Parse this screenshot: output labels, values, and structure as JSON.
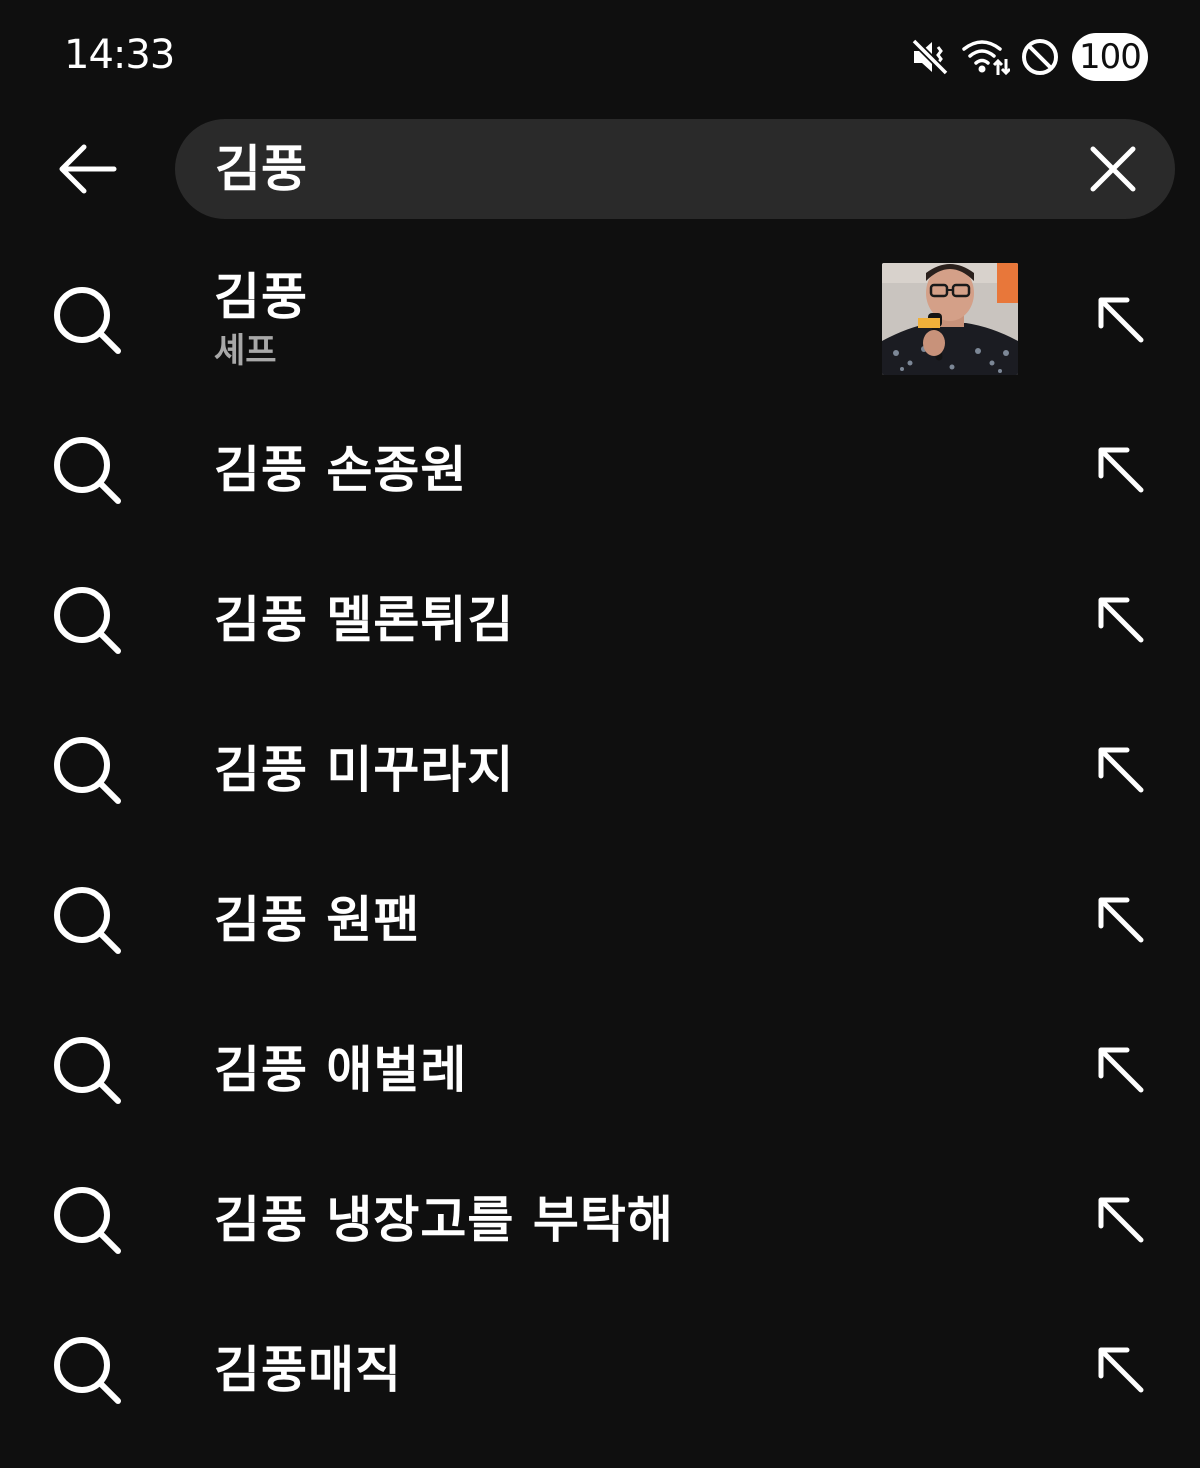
{
  "status_bar": {
    "time": "14:33",
    "icons": [
      "vibrate-icon",
      "wifi-icon",
      "do-not-disturb-icon"
    ],
    "battery": "100"
  },
  "search": {
    "back_icon": "arrow-left-icon",
    "query": "김풍",
    "clear_icon": "close-icon"
  },
  "suggestions": [
    {
      "title": "김풍",
      "subtitle": "셰프",
      "has_thumbnail": true
    },
    {
      "title": "김풍 손종원"
    },
    {
      "title": "김풍 멜론튀김"
    },
    {
      "title": "김풍 미꾸라지"
    },
    {
      "title": "김풍 원팬"
    },
    {
      "title": "김풍 애벌레"
    },
    {
      "title": "김풍 냉장고를 부탁해"
    },
    {
      "title": "김풍매직"
    }
  ],
  "colors": {
    "background": "#0f0f0f",
    "search_box": "#2a2a2a",
    "text": "#ffffff",
    "subtitle": "#a8a8a8"
  }
}
